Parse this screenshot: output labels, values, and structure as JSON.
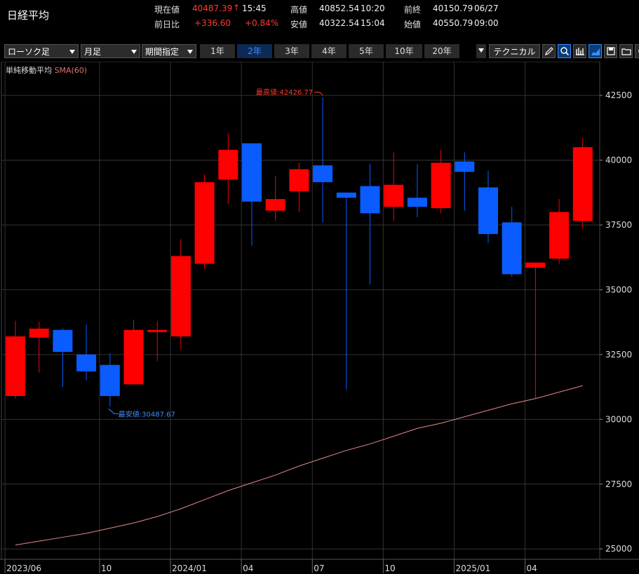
{
  "header": {
    "title": "日経平均",
    "row1": [
      {
        "label": "現在値",
        "value": "40487.39",
        "arrow": "↑",
        "time": "15:45"
      },
      {
        "label": "高値",
        "value": "40852.54",
        "time": "10:20"
      },
      {
        "label": "前終",
        "value": "40150.79",
        "time": "06/27"
      }
    ],
    "row2": [
      {
        "label": "前日比",
        "value": "+336.60",
        "pct": "+0.84%"
      },
      {
        "label": "安値",
        "value": "40322.54",
        "time": "15:04"
      },
      {
        "label": "始値",
        "value": "40550.79",
        "time": "09:00"
      }
    ]
  },
  "toolbar": {
    "chart_type": "ローソク足",
    "period": "月足",
    "range_mode": "期間指定",
    "ranges": [
      "1年",
      "2年",
      "3年",
      "4年",
      "5年",
      "10年",
      "20年"
    ],
    "active_range": "2年",
    "technical": "テクニカル"
  },
  "indicator": {
    "name": "単純移動平均",
    "param": "SMA(60)"
  },
  "colors": {
    "up": "#ff0000",
    "down": "#0a5cff",
    "sma": "#e08a8a",
    "grid": "#333333",
    "accent": "#3f8cff"
  },
  "chart_data": {
    "type": "candlestick",
    "y_ticks": [
      25000,
      27500,
      30000,
      32500,
      35000,
      37500,
      40000,
      42500
    ],
    "ylim": [
      24600,
      43800
    ],
    "x_tick_labels": [
      {
        "index": 0,
        "label": "2023/06"
      },
      {
        "index": 4,
        "label": "10"
      },
      {
        "index": 7,
        "label": "2024/01"
      },
      {
        "index": 10,
        "label": "04"
      },
      {
        "index": 13,
        "label": "07"
      },
      {
        "index": 16,
        "label": "10"
      },
      {
        "index": 19,
        "label": "2025/01"
      },
      {
        "index": 22,
        "label": "04"
      }
    ],
    "candles": [
      {
        "open": 30900,
        "high": 33800,
        "low": 30800,
        "close": 33200
      },
      {
        "open": 33150,
        "high": 33770,
        "low": 31800,
        "close": 33500
      },
      {
        "open": 33450,
        "high": 33500,
        "low": 31250,
        "close": 32600
      },
      {
        "open": 32500,
        "high": 33650,
        "low": 31500,
        "close": 31850
      },
      {
        "open": 32100,
        "high": 32550,
        "low": 30487.67,
        "close": 30900
      },
      {
        "open": 31350,
        "high": 33850,
        "low": 31350,
        "close": 33450
      },
      {
        "open": 33450,
        "high": 33800,
        "low": 32250,
        "close": 33450
      },
      {
        "open": 33200,
        "high": 36950,
        "low": 32700,
        "close": 36300
      },
      {
        "open": 36000,
        "high": 39450,
        "low": 35800,
        "close": 39150
      },
      {
        "open": 39250,
        "high": 41050,
        "low": 38300,
        "close": 40400
      },
      {
        "open": 40650,
        "high": 40650,
        "low": 36700,
        "close": 38400
      },
      {
        "open": 38050,
        "high": 39400,
        "low": 37650,
        "close": 38500
      },
      {
        "open": 38800,
        "high": 39900,
        "low": 38000,
        "close": 39650
      },
      {
        "open": 39800,
        "high": 42426.77,
        "low": 37600,
        "close": 39150
      },
      {
        "open": 38750,
        "high": 38750,
        "low": 31150,
        "close": 38550
      },
      {
        "open": 39000,
        "high": 39850,
        "low": 35200,
        "close": 37950
      },
      {
        "open": 38200,
        "high": 40300,
        "low": 37650,
        "close": 39050
      },
      {
        "open": 38550,
        "high": 39850,
        "low": 37800,
        "close": 38200
      },
      {
        "open": 38150,
        "high": 40400,
        "low": 37950,
        "close": 39900
      },
      {
        "open": 39950,
        "high": 40300,
        "low": 38050,
        "close": 39550
      },
      {
        "open": 38950,
        "high": 39600,
        "low": 36800,
        "close": 37150
      },
      {
        "open": 37600,
        "high": 38200,
        "low": 35500,
        "close": 35600
      },
      {
        "open": 35850,
        "high": 36000,
        "low": 30800,
        "close": 36050
      },
      {
        "open": 36200,
        "high": 38500,
        "low": 36000,
        "close": 38000
      },
      {
        "open": 37650,
        "high": 40850,
        "low": 37350,
        "close": 40500
      }
    ],
    "sma": [
      25150,
      25300,
      25450,
      25600,
      25800,
      26000,
      26250,
      26550,
      26900,
      27250,
      27550,
      27850,
      28200,
      28500,
      28800,
      29050,
      29350,
      29650,
      29850,
      30100,
      30350,
      30600,
      30800,
      31050,
      31300
    ],
    "annotations": [
      {
        "label": "最高値:42426.77",
        "index": 13,
        "value": 42426.77,
        "color": "#ff3b30"
      },
      {
        "label": "最安値:30487.67",
        "index": 4,
        "value": 30487.67,
        "color": "#3f8cff"
      }
    ]
  }
}
